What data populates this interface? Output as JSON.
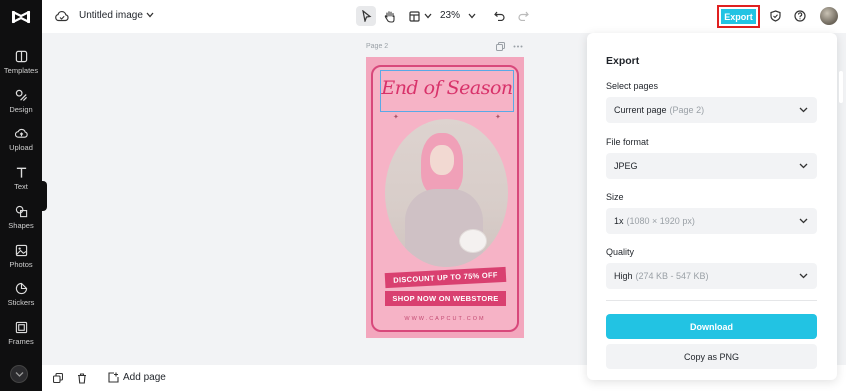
{
  "sidebar": {
    "items": [
      {
        "label": "Templates",
        "icon": "templates-icon"
      },
      {
        "label": "Design",
        "icon": "design-icon"
      },
      {
        "label": "Upload",
        "icon": "upload-icon"
      },
      {
        "label": "Text",
        "icon": "text-icon"
      },
      {
        "label": "Shapes",
        "icon": "shapes-icon"
      },
      {
        "label": "Photos",
        "icon": "photos-icon"
      },
      {
        "label": "Stickers",
        "icon": "stickers-icon"
      },
      {
        "label": "Frames",
        "icon": "frames-icon"
      }
    ]
  },
  "topbar": {
    "title": "Untitled image",
    "zoom": "23%",
    "export_label": "Export"
  },
  "canvas": {
    "page_label": "Page 2",
    "poster": {
      "headline": "End of Season",
      "ribbon1": "DISCOUNT UP TO 75% OFF",
      "ribbon2": "SHOP NOW ON WEBSTORE",
      "website": "WWW.CAPCUT.COM"
    }
  },
  "bottombar": {
    "add_page_label": "Add page"
  },
  "export_panel": {
    "title": "Export",
    "select_pages_label": "Select pages",
    "select_pages_value": "Current page",
    "select_pages_hint": "(Page 2)",
    "file_format_label": "File format",
    "file_format_value": "JPEG",
    "size_label": "Size",
    "size_value": "1x",
    "size_hint": "(1080 × 1920 px)",
    "quality_label": "Quality",
    "quality_value": "High",
    "quality_hint": "(274 KB - 547 KB)",
    "download_label": "Download",
    "copy_label": "Copy as PNG"
  },
  "colors": {
    "accent": "#22c3e3",
    "highlight_border": "#e02020",
    "poster_pink": "#f3a6bd",
    "ribbon": "#d94070"
  }
}
